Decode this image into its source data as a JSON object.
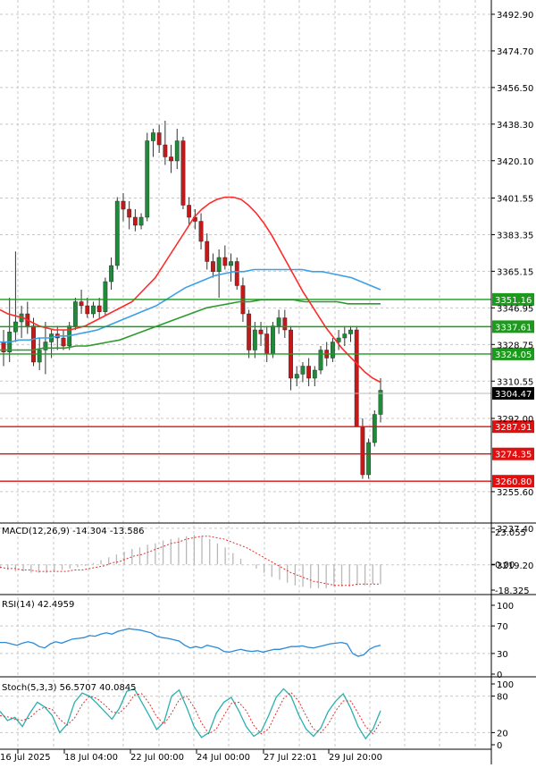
{
  "colors": {
    "background": "#ffffff",
    "grid": "#c8c8c8",
    "bull": "#1e8a3a",
    "bear": "#c21a1a",
    "ma_fast": "#ff2a2a",
    "ma_mid": "#3aa0e8",
    "ma_slow": "#2e9a2e",
    "support": "#e01010",
    "resistance": "#1c9a1c",
    "macd_hist": "#b8b8b8",
    "macd_signal": "#e03030",
    "rsi": "#2a8ad8",
    "stoch_main": "#2ab0b0",
    "stoch_signal": "#e03030",
    "current_price_bg": "#000000"
  },
  "price_axis_labels": [
    "3492.90",
    "3474.70",
    "3456.50",
    "3438.30",
    "3420.10",
    "3401.55",
    "3383.35",
    "3365.15",
    "3346.95",
    "3328.75",
    "3310.55",
    "3292.00",
    "3255.60",
    "3237.40",
    "3219.20"
  ],
  "current_price": "3304.47",
  "support_levels": [
    "3287.91",
    "3274.35",
    "3260.80"
  ],
  "resistance_levels": [
    "3351.16",
    "3337.61",
    "3324.05"
  ],
  "x_axis_labels": [
    "16 Jul 2025",
    "18 Jul 04:00",
    "22 Jul 00:00",
    "24 Jul 00:00",
    "27 Jul 22:01",
    "29 Jul 20:00"
  ],
  "macd": {
    "label": "MACD(12,26,9) -14.304 -13.586",
    "axis_labels": [
      "23.055",
      "0.00",
      "-18.325"
    ]
  },
  "rsi": {
    "label": "RSI(14) 42.4959",
    "axis_labels": [
      "100",
      "70",
      "30",
      "0"
    ]
  },
  "stoch": {
    "label": "Stoch(5,3,3) 56.5707 40.0845",
    "axis_labels": [
      "100",
      "80",
      "20",
      "0"
    ]
  },
  "chart_data": {
    "type": "candlestick",
    "ylim": [
      3240,
      3500
    ],
    "candles": [
      {
        "o": 3330,
        "h": 3336,
        "l": 3318,
        "c": 3325
      },
      {
        "o": 3325,
        "h": 3352,
        "l": 3320,
        "c": 3335
      },
      {
        "o": 3335,
        "h": 3375,
        "l": 3330,
        "c": 3340
      },
      {
        "o": 3340,
        "h": 3348,
        "l": 3332,
        "c": 3344
      },
      {
        "o": 3344,
        "h": 3350,
        "l": 3334,
        "c": 3338
      },
      {
        "o": 3338,
        "h": 3342,
        "l": 3318,
        "c": 3320
      },
      {
        "o": 3320,
        "h": 3332,
        "l": 3316,
        "c": 3326
      },
      {
        "o": 3326,
        "h": 3340,
        "l": 3314,
        "c": 3330
      },
      {
        "o": 3330,
        "h": 3336,
        "l": 3322,
        "c": 3334
      },
      {
        "o": 3334,
        "h": 3338,
        "l": 3326,
        "c": 3332
      },
      {
        "o": 3332,
        "h": 3336,
        "l": 3326,
        "c": 3328
      },
      {
        "o": 3328,
        "h": 3340,
        "l": 3326,
        "c": 3338
      },
      {
        "o": 3338,
        "h": 3352,
        "l": 3336,
        "c": 3350
      },
      {
        "o": 3350,
        "h": 3356,
        "l": 3344,
        "c": 3348
      },
      {
        "o": 3348,
        "h": 3352,
        "l": 3342,
        "c": 3344
      },
      {
        "o": 3344,
        "h": 3350,
        "l": 3342,
        "c": 3348
      },
      {
        "o": 3348,
        "h": 3352,
        "l": 3342,
        "c": 3345
      },
      {
        "o": 3345,
        "h": 3362,
        "l": 3343,
        "c": 3360
      },
      {
        "o": 3360,
        "h": 3372,
        "l": 3356,
        "c": 3368
      },
      {
        "o": 3368,
        "h": 3402,
        "l": 3366,
        "c": 3400
      },
      {
        "o": 3400,
        "h": 3404,
        "l": 3390,
        "c": 3396
      },
      {
        "o": 3396,
        "h": 3400,
        "l": 3386,
        "c": 3392
      },
      {
        "o": 3392,
        "h": 3396,
        "l": 3385,
        "c": 3388
      },
      {
        "o": 3388,
        "h": 3394,
        "l": 3386,
        "c": 3392
      },
      {
        "o": 3392,
        "h": 3434,
        "l": 3390,
        "c": 3430
      },
      {
        "o": 3430,
        "h": 3436,
        "l": 3422,
        "c": 3434
      },
      {
        "o": 3434,
        "h": 3438,
        "l": 3424,
        "c": 3428
      },
      {
        "o": 3428,
        "h": 3440,
        "l": 3418,
        "c": 3422
      },
      {
        "o": 3422,
        "h": 3428,
        "l": 3414,
        "c": 3420
      },
      {
        "o": 3420,
        "h": 3436,
        "l": 3416,
        "c": 3430
      },
      {
        "o": 3430,
        "h": 3432,
        "l": 3396,
        "c": 3398
      },
      {
        "o": 3398,
        "h": 3402,
        "l": 3388,
        "c": 3392
      },
      {
        "o": 3392,
        "h": 3396,
        "l": 3386,
        "c": 3390
      },
      {
        "o": 3390,
        "h": 3394,
        "l": 3376,
        "c": 3380
      },
      {
        "o": 3380,
        "h": 3384,
        "l": 3366,
        "c": 3370
      },
      {
        "o": 3370,
        "h": 3374,
        "l": 3362,
        "c": 3365
      },
      {
        "o": 3365,
        "h": 3376,
        "l": 3352,
        "c": 3372
      },
      {
        "o": 3372,
        "h": 3378,
        "l": 3366,
        "c": 3368
      },
      {
        "o": 3368,
        "h": 3374,
        "l": 3360,
        "c": 3370
      },
      {
        "o": 3370,
        "h": 3372,
        "l": 3356,
        "c": 3358
      },
      {
        "o": 3358,
        "h": 3362,
        "l": 3340,
        "c": 3344
      },
      {
        "o": 3344,
        "h": 3346,
        "l": 3322,
        "c": 3326
      },
      {
        "o": 3326,
        "h": 3340,
        "l": 3322,
        "c": 3336
      },
      {
        "o": 3336,
        "h": 3340,
        "l": 3328,
        "c": 3334
      },
      {
        "o": 3334,
        "h": 3338,
        "l": 3320,
        "c": 3324
      },
      {
        "o": 3324,
        "h": 3340,
        "l": 3322,
        "c": 3338
      },
      {
        "o": 3338,
        "h": 3346,
        "l": 3334,
        "c": 3342
      },
      {
        "o": 3342,
        "h": 3346,
        "l": 3332,
        "c": 3336
      },
      {
        "o": 3336,
        "h": 3338,
        "l": 3306,
        "c": 3312
      },
      {
        "o": 3312,
        "h": 3318,
        "l": 3308,
        "c": 3314
      },
      {
        "o": 3314,
        "h": 3320,
        "l": 3310,
        "c": 3318
      },
      {
        "o": 3318,
        "h": 3322,
        "l": 3308,
        "c": 3312
      },
      {
        "o": 3312,
        "h": 3318,
        "l": 3308,
        "c": 3316
      },
      {
        "o": 3316,
        "h": 3328,
        "l": 3314,
        "c": 3326
      },
      {
        "o": 3326,
        "h": 3330,
        "l": 3318,
        "c": 3322
      },
      {
        "o": 3322,
        "h": 3332,
        "l": 3320,
        "c": 3330
      },
      {
        "o": 3330,
        "h": 3336,
        "l": 3326,
        "c": 3332
      },
      {
        "o": 3332,
        "h": 3338,
        "l": 3328,
        "c": 3334
      },
      {
        "o": 3334,
        "h": 3338,
        "l": 3330,
        "c": 3336
      },
      {
        "o": 3336,
        "h": 3338,
        "l": 3312,
        "c": 3288
      },
      {
        "o": 3288,
        "h": 3292,
        "l": 3262,
        "c": 3264
      },
      {
        "o": 3264,
        "h": 3282,
        "l": 3262,
        "c": 3280
      },
      {
        "o": 3280,
        "h": 3296,
        "l": 3278,
        "c": 3294
      },
      {
        "o": 3294,
        "h": 3312,
        "l": 3290,
        "c": 3306
      }
    ],
    "ma_fast": [
      3346,
      3344,
      3343,
      3342,
      3340,
      3338,
      3337,
      3336,
      3336,
      3336,
      3337,
      3338,
      3340,
      3342,
      3344,
      3346,
      3348,
      3350,
      3354,
      3358,
      3362,
      3368,
      3374,
      3380,
      3386,
      3392,
      3396,
      3399,
      3401,
      3402,
      3402,
      3401,
      3398,
      3394,
      3389,
      3383,
      3376,
      3369,
      3362,
      3355,
      3349,
      3343,
      3337,
      3332,
      3327,
      3323,
      3319,
      3315,
      3312,
      3310
    ],
    "ma_mid": [
      3330,
      3330,
      3331,
      3331,
      3332,
      3332,
      3333,
      3333,
      3334,
      3335,
      3336,
      3338,
      3340,
      3342,
      3344,
      3346,
      3348,
      3351,
      3354,
      3357,
      3359,
      3361,
      3363,
      3364,
      3365,
      3365,
      3366,
      3366,
      3366,
      3366,
      3366,
      3366,
      3365,
      3365,
      3364,
      3363,
      3362,
      3360,
      3358,
      3356
    ],
    "ma_slow": [
      3326,
      3326,
      3326,
      3326,
      3327,
      3327,
      3327,
      3328,
      3328,
      3329,
      3330,
      3331,
      3333,
      3335,
      3337,
      3339,
      3341,
      3343,
      3345,
      3347,
      3348,
      3349,
      3350,
      3350,
      3351,
      3351,
      3351,
      3351,
      3350,
      3350,
      3350,
      3350,
      3349,
      3349,
      3349,
      3349
    ],
    "macd_hist": [
      -3,
      -4,
      -5,
      -5,
      -6,
      -6,
      -6,
      -5,
      -4,
      -3,
      -2,
      -1,
      1,
      3,
      5,
      7,
      9,
      11,
      12,
      14,
      15,
      17,
      18,
      19,
      20,
      21,
      20,
      18,
      15,
      12,
      8,
      4,
      0,
      -3,
      -6,
      -9,
      -11,
      -13,
      -15,
      -16,
      -17,
      -17,
      -17,
      -16,
      -16,
      -16,
      -15,
      -15,
      -14,
      -14
    ],
    "macd_signal": [
      -2,
      -3,
      -3,
      -4,
      -4,
      -5,
      -5,
      -5,
      -5,
      -5,
      -4,
      -4,
      -3,
      -2,
      -1,
      1,
      2,
      4,
      6,
      7,
      9,
      11,
      13,
      15,
      16,
      18,
      19,
      20,
      20,
      19,
      18,
      16,
      14,
      12,
      9,
      6,
      3,
      0,
      -3,
      -6,
      -8,
      -10,
      -12,
      -13,
      -14,
      -15,
      -15,
      -15,
      -14,
      -14,
      -14,
      -14
    ],
    "rsi": [
      46,
      46,
      44,
      42,
      45,
      47,
      45,
      40,
      38,
      44,
      47,
      45,
      48,
      51,
      52,
      53,
      56,
      55,
      58,
      60,
      58,
      62,
      64,
      66,
      65,
      64,
      62,
      60,
      55,
      53,
      52,
      50,
      48,
      42,
      38,
      40,
      38,
      42,
      40,
      38,
      33,
      32,
      34,
      36,
      34,
      33,
      34,
      32,
      34,
      36,
      36,
      38,
      40,
      40,
      41,
      39,
      38,
      40,
      42,
      44,
      45,
      46,
      44,
      30,
      26,
      28,
      36,
      40,
      42
    ],
    "stoch_main": [
      55,
      40,
      45,
      30,
      52,
      70,
      62,
      48,
      20,
      34,
      70,
      85,
      80,
      68,
      55,
      42,
      60,
      88,
      92,
      70,
      48,
      25,
      38,
      80,
      90,
      62,
      30,
      12,
      20,
      52,
      70,
      78,
      56,
      30,
      14,
      22,
      48,
      78,
      92,
      80,
      50,
      26,
      14,
      28,
      55,
      72,
      84,
      60,
      30,
      10,
      26,
      56
    ],
    "stoch_signal": [
      48,
      46,
      42,
      40,
      44,
      56,
      62,
      58,
      42,
      32,
      44,
      66,
      80,
      76,
      66,
      54,
      52,
      64,
      82,
      84,
      68,
      46,
      34,
      52,
      74,
      80,
      62,
      36,
      18,
      26,
      48,
      68,
      70,
      56,
      32,
      18,
      26,
      52,
      76,
      86,
      72,
      48,
      26,
      20,
      34,
      56,
      72,
      72,
      52,
      30,
      18,
      38
    ]
  }
}
